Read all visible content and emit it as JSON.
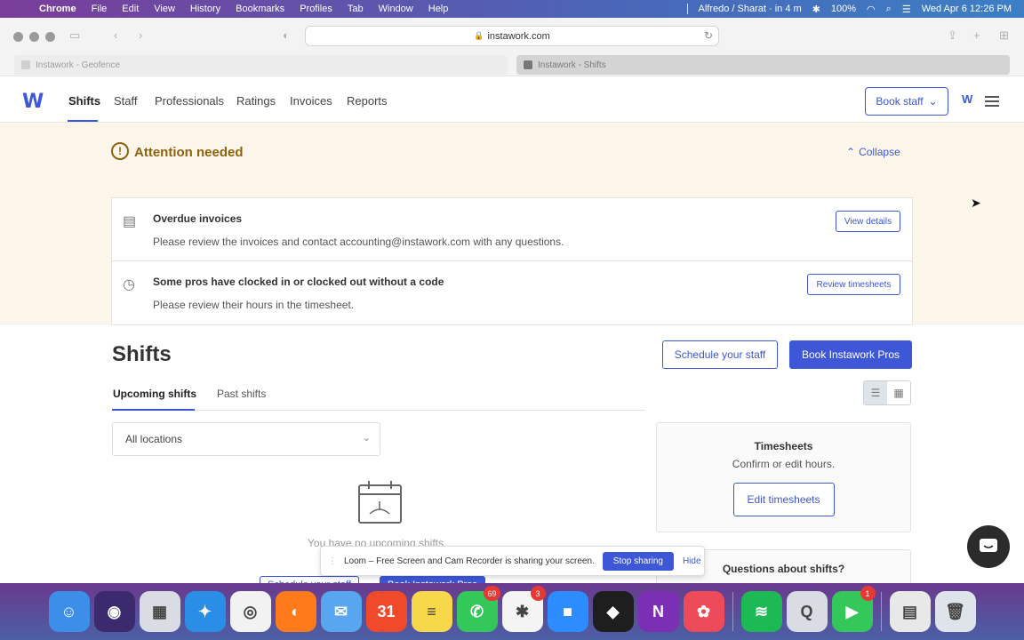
{
  "menubar": {
    "items": [
      "Chrome",
      "File",
      "Edit",
      "View",
      "History",
      "Bookmarks",
      "Profiles",
      "Tab",
      "Window",
      "Help"
    ],
    "meeting": "Alfredo / Sharat · in 4 m",
    "battery": "100%",
    "datetime": "Wed Apr 6  12:26 PM"
  },
  "browser": {
    "url": "instawork.com",
    "tabs": [
      {
        "title": "Instawork - Geofence"
      },
      {
        "title": "Instawork - Shifts"
      }
    ]
  },
  "nav": {
    "logo": "W",
    "links": [
      "Shifts",
      "Staff",
      "Professionals",
      "Ratings",
      "Invoices",
      "Reports"
    ],
    "active": "Shifts",
    "book_staff": "Book staff"
  },
  "attention": {
    "title": "Attention needed",
    "collapse": "Collapse",
    "cards": [
      {
        "heading": "Overdue invoices",
        "text": "Please review the invoices and contact accounting@instawork.com with any questions.",
        "button": "View details",
        "icon": "invoice-icon"
      },
      {
        "heading": "Some pros have clocked in or clocked out without a code",
        "text": "Please review their hours in the timesheet.",
        "button": "Review timesheets",
        "icon": "clock-icon"
      }
    ]
  },
  "shifts": {
    "title": "Shifts",
    "schedule_btn": "Schedule your staff",
    "book_btn": "Book Instawork Pros",
    "tabs": [
      "Upcoming shifts",
      "Past shifts"
    ],
    "location_select": "All locations",
    "empty": "You have no upcoming shifts",
    "peek_buttons": [
      "Schedule your staff",
      "Book Instawork Pros"
    ]
  },
  "timesheets": {
    "title": "Timesheets",
    "subtitle": "Confirm or edit hours.",
    "button": "Edit timesheets"
  },
  "questions": {
    "title": "Questions about shifts?"
  },
  "loom": {
    "message": "Loom – Free Screen and Cam Recorder is sharing your screen.",
    "stop": "Stop sharing",
    "hide": "Hide"
  },
  "dock": {
    "apps": [
      {
        "name": "finder",
        "color": "#3d8ee8",
        "glyph": "☺"
      },
      {
        "name": "siri",
        "color": "#3b2b6e",
        "glyph": "◉"
      },
      {
        "name": "launchpad",
        "color": "#d9dde3",
        "glyph": "▦"
      },
      {
        "name": "safari",
        "color": "#2a8ee6",
        "glyph": "✦"
      },
      {
        "name": "chrome",
        "color": "#f2f2f2",
        "glyph": "◎"
      },
      {
        "name": "firefox",
        "color": "#ff7a1a",
        "glyph": "◐"
      },
      {
        "name": "mail",
        "color": "#58a6f0",
        "glyph": "✉"
      },
      {
        "name": "calendar",
        "color": "#f04a2a",
        "glyph": "31"
      },
      {
        "name": "notes",
        "color": "#f6d84a",
        "glyph": "≡"
      },
      {
        "name": "messages",
        "color": "#34c759",
        "glyph": "✆",
        "badge": "69"
      },
      {
        "name": "slack",
        "color": "#f4f4f4",
        "glyph": "✱",
        "badge": "3"
      },
      {
        "name": "zoom",
        "color": "#2d8cff",
        "glyph": "■"
      },
      {
        "name": "figma",
        "color": "#1e1e1e",
        "glyph": "◆"
      },
      {
        "name": "onenote",
        "color": "#7b2fb5",
        "glyph": "N"
      },
      {
        "name": "craft",
        "color": "#ee4b5a",
        "glyph": "✿"
      },
      {
        "name": "spotify",
        "color": "#1db954",
        "glyph": "≋"
      },
      {
        "name": "quicktime",
        "color": "#d9dde3",
        "glyph": "Q"
      },
      {
        "name": "facetime",
        "color": "#34c759",
        "glyph": "▶",
        "badge": "1"
      },
      {
        "name": "documents",
        "color": "#e8e8e8",
        "glyph": "▤"
      },
      {
        "name": "trash",
        "color": "#dfe3ea",
        "glyph": "🗑"
      }
    ]
  }
}
